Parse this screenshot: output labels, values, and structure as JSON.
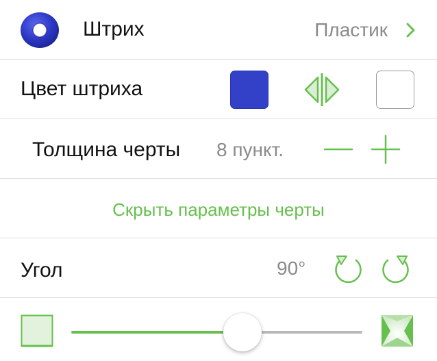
{
  "stroke": {
    "label": "Штрих",
    "value": "Пластик",
    "icon": "blue-ring-icon",
    "chevron_icon": "chevron-right-icon"
  },
  "stroke_color": {
    "label": "Цвет штриха",
    "primary_color": "#3340c8",
    "secondary_color": "#ffffff",
    "swap_icon": "swap-colors-icon"
  },
  "dash_width": {
    "label": "Толщина черты",
    "value": "8 пункт.",
    "decrement_icon": "minus-icon",
    "increment_icon": "plus-icon"
  },
  "hide_dash_params": {
    "label": "Скрыть параметры черты"
  },
  "angle": {
    "label": "Угол",
    "value": "90°",
    "rotate_left_icon": "rotate-ccw-icon",
    "rotate_right_icon": "rotate-cw-icon"
  },
  "gradient_slider": {
    "position": 0.5,
    "start_icon": "flat-square-icon",
    "end_icon": "beveled-square-icon"
  },
  "colors": {
    "accent": "#66c04e",
    "text": "#111111",
    "secondary_text": "#8a8a8a",
    "separator": "#dedede"
  }
}
